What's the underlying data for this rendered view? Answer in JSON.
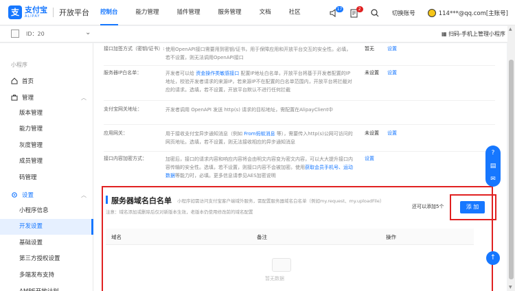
{
  "topnav": {
    "logo_cn": "支付宝",
    "logo_en": "ALIPAY",
    "platform": "开放平台",
    "items": [
      "控制台",
      "能力管理",
      "插件管理",
      "服务管理",
      "文档",
      "社区"
    ],
    "sound_badge": "17",
    "msg_badge": "2",
    "switch_account": "切换账号",
    "account": "114***@qq.com[主账号]"
  },
  "appbar": {
    "id_label": "ID：20",
    "scan": "扫码-手机上管理小程序"
  },
  "sidebar": {
    "category": "小程序",
    "home": "首页",
    "manage": "管理",
    "manage_items": [
      "版本管理",
      "能力管理",
      "灰度管理",
      "成员管理",
      "码管理"
    ],
    "settings": "设置",
    "settings_items": [
      "小程序信息",
      "开发设置",
      "基础设置",
      "第三方授权设置",
      "多端发布支持",
      "AMPE开放计划"
    ]
  },
  "config": {
    "rows": [
      {
        "label": "接口加签方式（密钥/证书）:",
        "desc": "使用OpenAPI接口需要用到密钥/证书，用于保障应用和开放平台交互的安全性。必填，若不设置，则无法调用OpenAPI接口",
        "status": "暂无",
        "action": "设置"
      },
      {
        "label": "服务器IP白名单：",
        "desc_pre": "开发者可以给",
        "desc_link": "资金操作类敏感接口",
        "desc_post": "配置IP地址白名单，开放平台将基于开发者配置的IP地址，校验开发者请求的来源IP，若来源IP不在配置的白名单范围内，开放平台将拦截对应的请求。选填，若不设置，开放平台默认不进行任何拦截",
        "status": "未设置",
        "action": "设置"
      },
      {
        "label": "支付宝网关地址：",
        "desc": "开发者调用 OpenAPI 发送 http(s) 请求的目标地址，需配置在AlipayClient中",
        "status": "",
        "action": ""
      },
      {
        "label": "应用网关：",
        "desc_pre": "用于接收支付宝异步通知消息（例如",
        "desc_link": "From蚂蚁消息",
        "desc_post": "等），需要传入http(s)公网可访问的网页地址。选填，若不设置，则无法接收相应的异步通知消息",
        "status": "未设置",
        "action": "设置"
      },
      {
        "label": "接口内容加密方式：",
        "desc_pre": "加密后，接口的请求内容和响应内容将会由明文内容变为密文内容，可以大大提升接口内容传输的安全性。选填，若不设置，则接口内容不会被加密。使用",
        "desc_link": "获取会员手机号、运动数据",
        "desc_post": "等能力时，必填。更多信息请参见AES加密说明",
        "status": "",
        "action": "设置"
      }
    ]
  },
  "whitelist": {
    "title": "服务器域名白名单",
    "hint": "小程序如需访问支付宝客户端域外服务，需配置服务器域名白名单（例如my.request、my.uploadFile）",
    "note": "注意：域名添加或删除后仅对新版本生效，老版本仍使用修改前的域名配置",
    "remain": "还可以添加5个",
    "add_button": "添 加",
    "columns": [
      "域名",
      "备注",
      "操作"
    ],
    "empty": "暂无数据"
  }
}
